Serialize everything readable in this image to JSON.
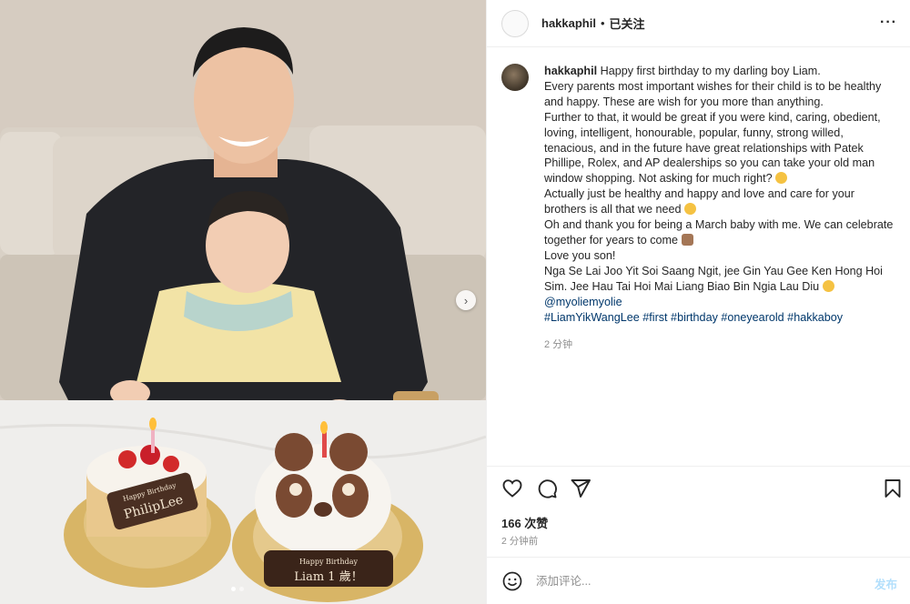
{
  "post": {
    "username": "hakkaphil",
    "follow_separator": "•",
    "follow_status": "已关注",
    "more_icon": "more-horizontal-icon"
  },
  "caption": {
    "username": "hakkaphil",
    "lines": [
      "Happy first birthday to my darling boy Liam.",
      "Every parents most important wishes for their child is to be healthy and happy. These are wish for you more than anything.",
      "Further to that, it would be great if you were kind, caring, obedient, loving, intelligent, honourable, popular, funny, strong willed, tenacious, and in the future have great relationships with Patek Phillipe, Rolex, and AP dealerships so you can take your old man window shopping. Not asking for much right?",
      "Actually just be healthy and happy and love and care for your brothers is all that we need",
      "Oh and thank you for being a March baby with me. We can celebrate together for years to come",
      "Love you son!",
      "Nga Se Lai Joo Yit Soi Saang Ngit, jee Gin Yau Gee Ken Hong Hoi Sim. Jee Hau Tai Hoi Mai Liang Biao Bin Ngia Lau Diu"
    ],
    "mention": "@myoliemyolie",
    "hashtags": "#LiamYikWangLee #first #birthday #oneyearold #hakkaboy",
    "time": "2 分钟"
  },
  "photo": {
    "cake_left_text_1": "Happy Birthday",
    "cake_left_text_2": "PhilipLee",
    "cake_right_text_1": "Happy Birthday",
    "cake_right_text_2": "Liam 1 歲！",
    "carousel_next": "›",
    "dots_count": 2
  },
  "engagement": {
    "likes": "166 次赞",
    "time": "2 分钟前"
  },
  "comment": {
    "placeholder": "添加评论...",
    "post_label": "发布"
  }
}
